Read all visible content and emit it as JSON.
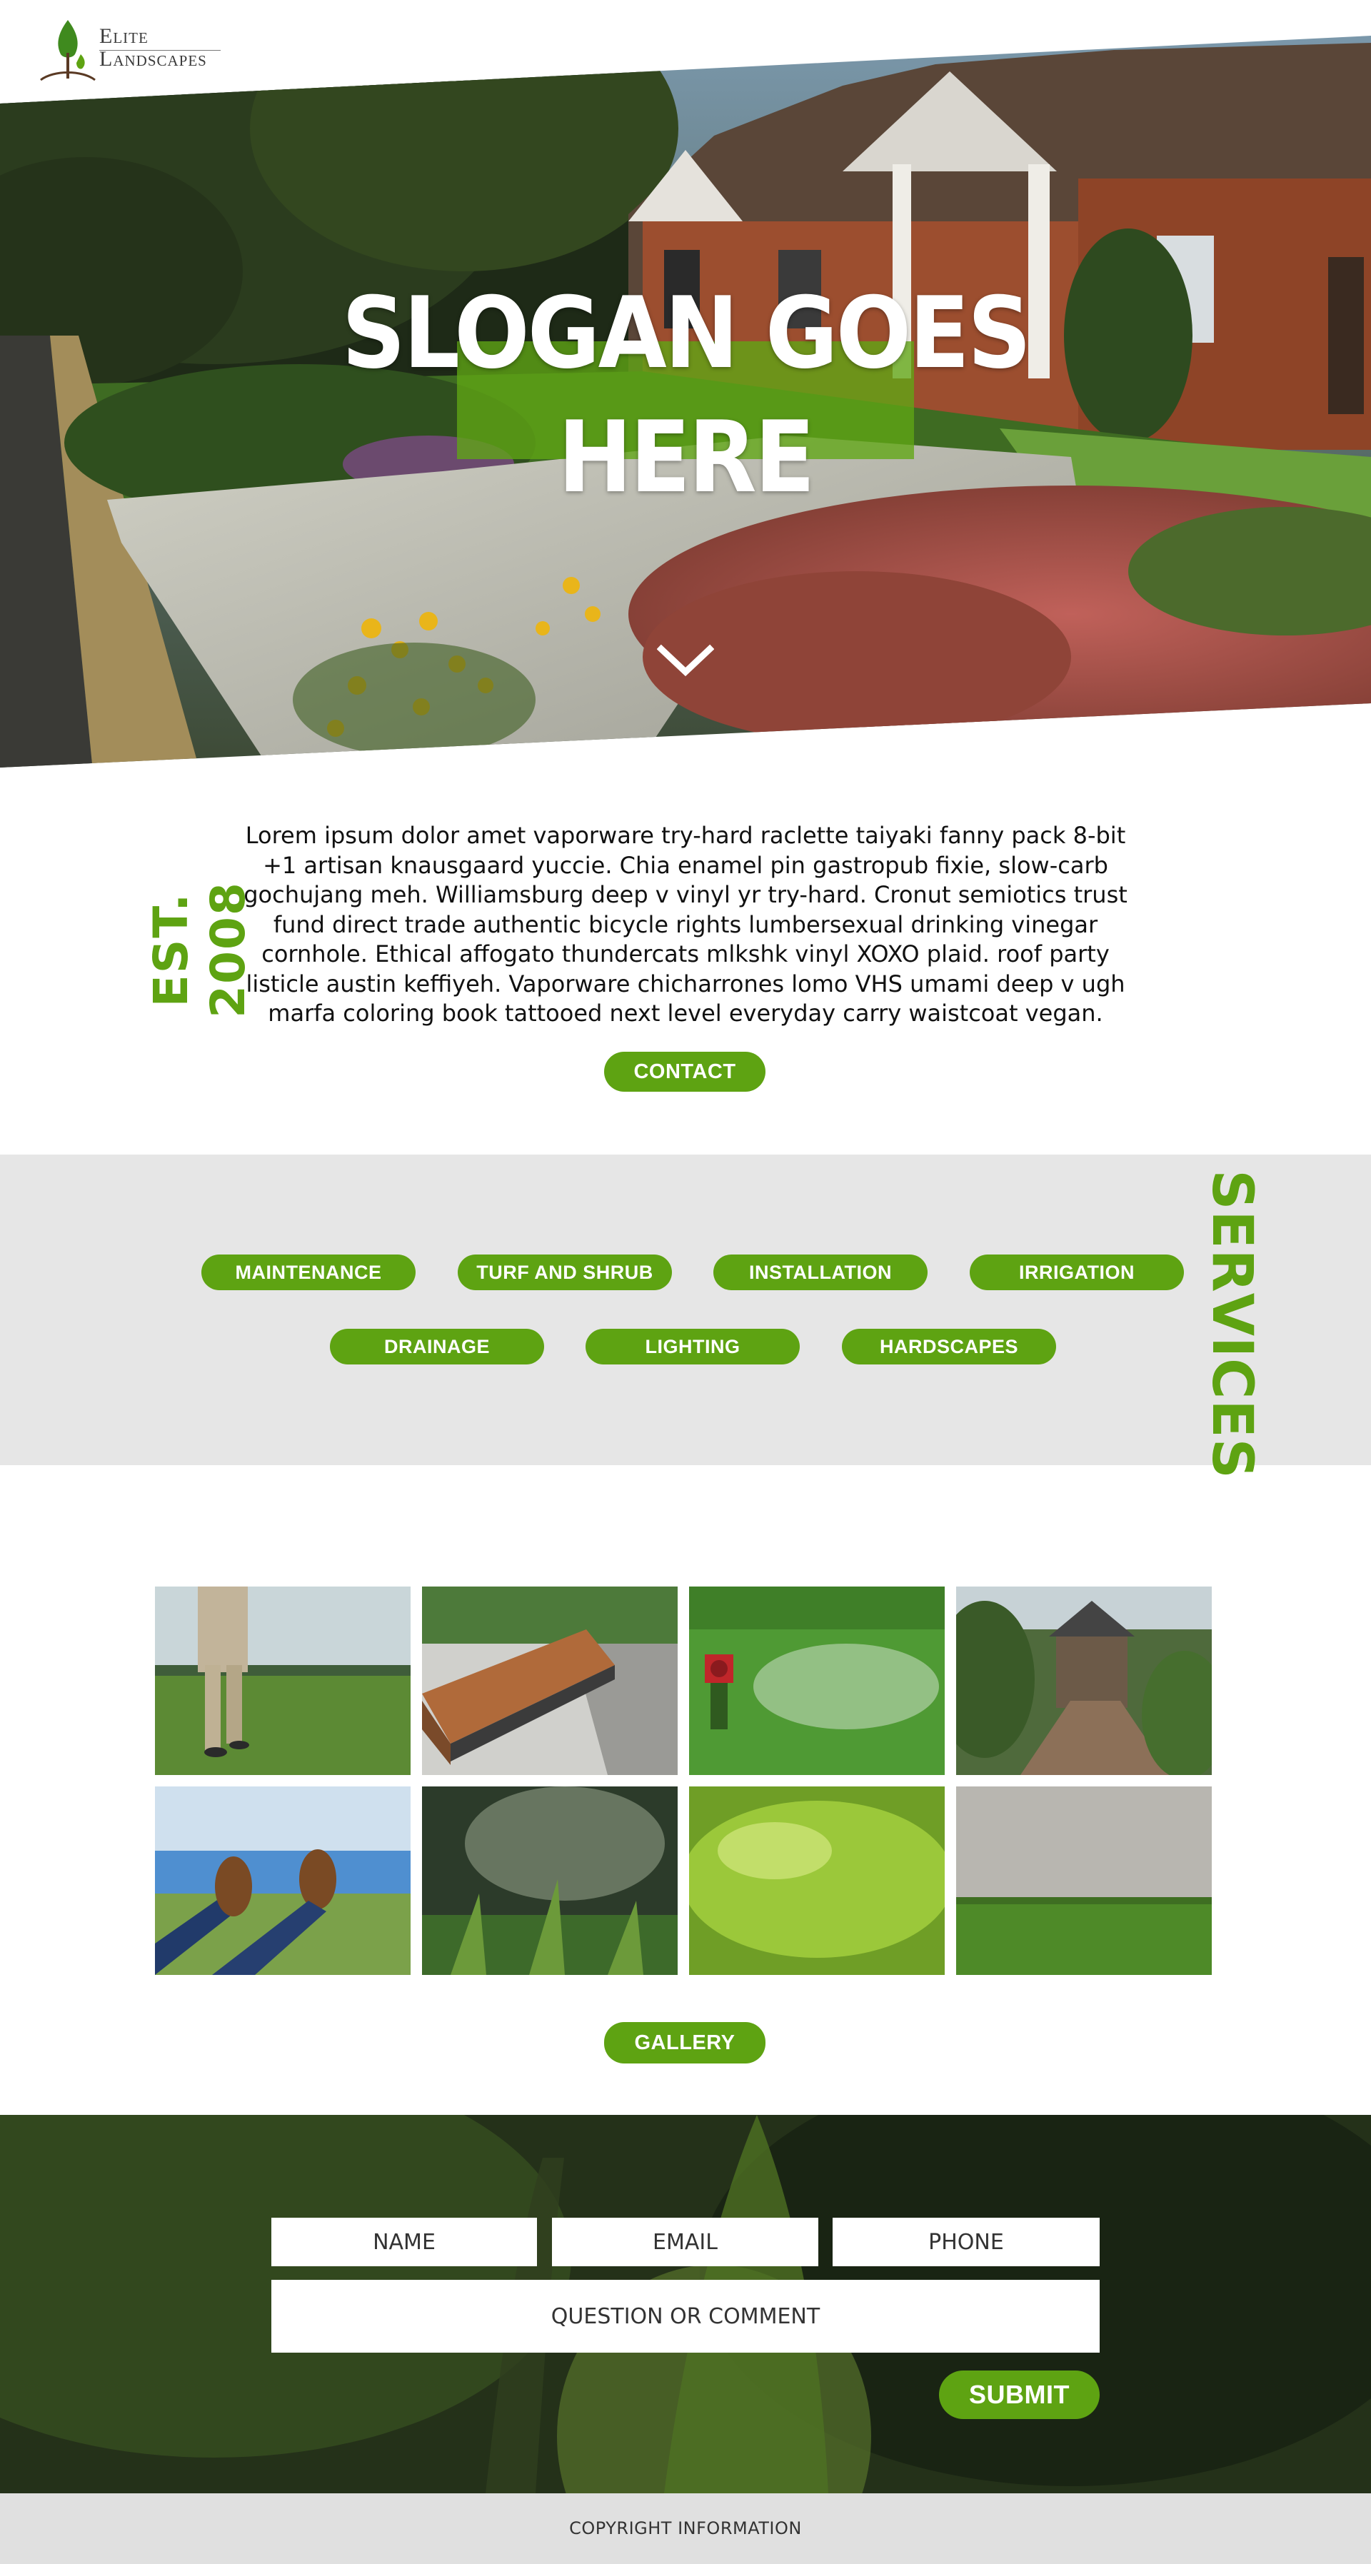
{
  "logo": {
    "line1": "Elite",
    "line2": "Landscapes"
  },
  "hero": {
    "slogan_line1": "SLOGAN GOES",
    "slogan_line2": "HERE",
    "scroll_icon": "chevron-down-icon"
  },
  "about": {
    "established": "EST. 2008",
    "body": "Lorem ipsum dolor amet vaporware try-hard raclette taiyaki fanny pack 8-bit +1 artisan knausgaard yuccie. Chia enamel pin gastropub fixie, slow-carb gochujang meh. Williamsburg deep v vinyl yr try-hard. Cronut semiotics trust fund direct trade authentic bicycle rights lumbersexual drinking vinegar cornhole. Ethical affogato thundercats mlkshk vinyl XOXO plaid. roof party listicle austin keffiyeh. Vaporware chicharrones lomo VHS umami deep v ugh marfa coloring book tattooed next level everyday carry waistcoat vegan.",
    "contact_label": "CONTACT"
  },
  "services": {
    "title": "SERVICES",
    "row1": [
      "MAINTENANCE",
      "TURF AND SHRUB",
      "INSTALLATION",
      "IRRIGATION"
    ],
    "row2": [
      "DRAINAGE",
      "LIGHTING",
      "HARDSCAPES"
    ]
  },
  "gallery": {
    "button_label": "GALLERY",
    "images": [
      "golfer-on-course",
      "wooden-bench",
      "lawn-sprinkler",
      "garden-path-house",
      "feet-by-lake",
      "grass-closeup-dark",
      "fresh-green-grass",
      "concrete-wall-lawn"
    ]
  },
  "contact_form": {
    "name_placeholder": "NAME",
    "email_placeholder": "EMAIL",
    "phone_placeholder": "PHONE",
    "comment_placeholder": "QUESTION OR COMMENT",
    "submit_label": "SUBMIT"
  },
  "footer": {
    "copyright": "COPYRIGHT INFORMATION"
  },
  "colors": {
    "accent": "#5ea312",
    "services_bg": "#e6e6e6",
    "footer_bg": "#e0e0e0"
  }
}
